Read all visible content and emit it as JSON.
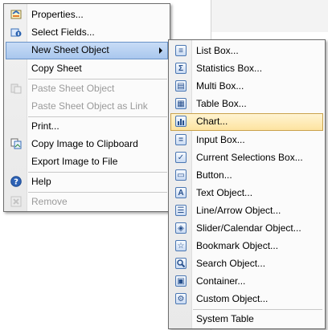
{
  "main_menu": {
    "items": [
      {
        "label": "Properties...",
        "icon": "properties-icon"
      },
      {
        "label": "Select Fields...",
        "icon": "select-fields-icon"
      },
      {
        "label": "New Sheet Object",
        "has_submenu": true
      },
      {
        "label": "Copy Sheet"
      },
      {
        "label": "Paste Sheet Object",
        "disabled": true,
        "icon": "paste-icon"
      },
      {
        "label": "Paste Sheet Object as Link",
        "disabled": true
      },
      {
        "label": "Print..."
      },
      {
        "label": "Copy Image to Clipboard",
        "icon": "copy-image-icon"
      },
      {
        "label": "Export Image to File"
      },
      {
        "label": "Help",
        "icon": "help-icon"
      },
      {
        "label": "Remove",
        "disabled": true,
        "icon": "remove-icon"
      }
    ]
  },
  "submenu": {
    "items": [
      {
        "label": "List Box...",
        "icon": "list-box-icon"
      },
      {
        "label": "Statistics Box...",
        "icon": "statistics-box-icon"
      },
      {
        "label": "Multi Box...",
        "icon": "multi-box-icon"
      },
      {
        "label": "Table Box...",
        "icon": "table-box-icon"
      },
      {
        "label": "Chart...",
        "icon": "chart-icon",
        "highlighted": true
      },
      {
        "label": "Input Box...",
        "icon": "input-box-icon"
      },
      {
        "label": "Current Selections Box...",
        "icon": "current-selections-icon"
      },
      {
        "label": "Button...",
        "icon": "button-icon"
      },
      {
        "label": "Text Object...",
        "icon": "text-object-icon"
      },
      {
        "label": "Line/Arrow Object...",
        "icon": "line-arrow-icon"
      },
      {
        "label": "Slider/Calendar Object...",
        "icon": "slider-calendar-icon"
      },
      {
        "label": "Bookmark Object...",
        "icon": "bookmark-icon"
      },
      {
        "label": "Search Object...",
        "icon": "search-object-icon"
      },
      {
        "label": "Container...",
        "icon": "container-icon"
      },
      {
        "label": "Custom Object...",
        "icon": "custom-object-icon"
      },
      {
        "label": "System Table"
      }
    ]
  },
  "colors": {
    "highlight": "#fde3a0",
    "highlight_border": "#c9a24c",
    "selected_blue": "#a9c7ee",
    "icon_blue": "#4a76b2"
  }
}
